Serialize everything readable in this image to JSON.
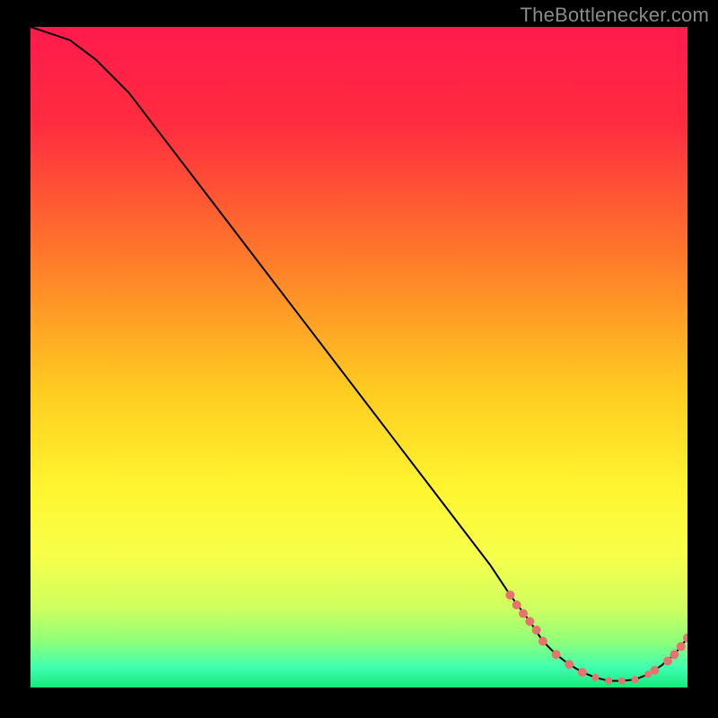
{
  "watermark": "TheBottlenecker.com",
  "chart_data": {
    "type": "line",
    "title": "",
    "xlabel": "",
    "ylabel": "",
    "xlim": [
      0,
      100
    ],
    "ylim": [
      0,
      100
    ],
    "x": [
      0,
      6,
      10,
      15,
      20,
      25,
      30,
      35,
      40,
      45,
      50,
      55,
      60,
      65,
      70,
      73,
      76,
      78,
      80,
      82,
      84,
      86,
      88,
      90,
      92,
      94,
      96,
      98,
      100
    ],
    "values": [
      100,
      98,
      95,
      90,
      83.5,
      77,
      70.5,
      64,
      57.5,
      51,
      44.5,
      38,
      31.5,
      25,
      18.5,
      14,
      10,
      7,
      5,
      3.5,
      2.3,
      1.5,
      1.0,
      1.0,
      1.2,
      2.0,
      3.3,
      5.0,
      7.5
    ],
    "highlight_points": {
      "x": [
        73,
        74,
        75,
        76,
        77,
        78,
        80,
        82,
        84,
        86,
        88,
        90,
        92,
        94,
        95,
        97,
        98,
        99,
        100
      ],
      "y": [
        14,
        12.5,
        11.2,
        10,
        8.7,
        7,
        5,
        3.5,
        2.3,
        1.5,
        1.0,
        1.0,
        1.2,
        2.0,
        2.6,
        4.0,
        5.0,
        6.2,
        7.5
      ]
    },
    "gradient_stops": [
      {
        "offset": 0.0,
        "color": "#ff1a4d"
      },
      {
        "offset": 0.15,
        "color": "#ff2d3f"
      },
      {
        "offset": 0.35,
        "color": "#ff7a2a"
      },
      {
        "offset": 0.55,
        "color": "#ffcc20"
      },
      {
        "offset": 0.7,
        "color": "#fff630"
      },
      {
        "offset": 0.8,
        "color": "#f7ff4a"
      },
      {
        "offset": 0.88,
        "color": "#ceff60"
      },
      {
        "offset": 0.93,
        "color": "#8fff7a"
      },
      {
        "offset": 0.97,
        "color": "#3fffb0"
      },
      {
        "offset": 1.0,
        "color": "#17e879"
      }
    ],
    "marker_color": "#e6736e",
    "line_color": "#000000"
  }
}
